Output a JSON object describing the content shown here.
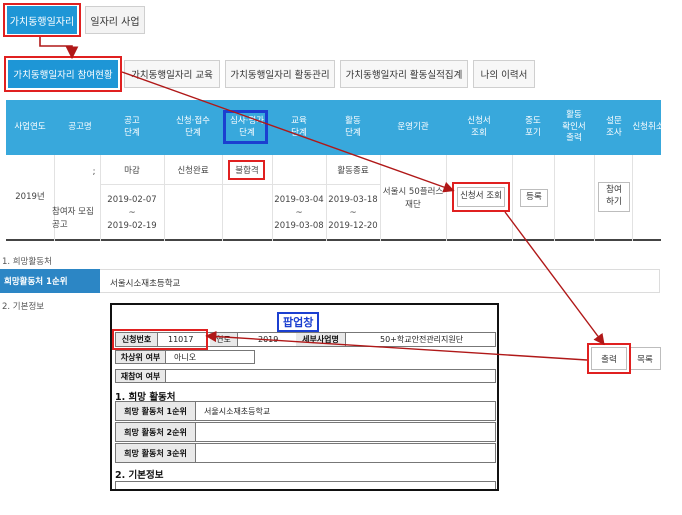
{
  "top_tabs": [
    {
      "label": "가치동행일자리",
      "active": true
    },
    {
      "label": "일자리 사업",
      "active": false
    }
  ],
  "sub_tabs": [
    {
      "label": "가치동행일자리 참여현황",
      "active": true
    },
    {
      "label": "가치동행일자리 교육",
      "active": false
    },
    {
      "label": "가치동행일자리 활동관리",
      "active": false
    },
    {
      "label": "가치동행일자리 활동실적집계",
      "active": false
    },
    {
      "label": "나의 이력서",
      "active": false
    }
  ],
  "table": {
    "headers": [
      "사업연도",
      "공고명",
      "공고\n단계",
      "신청·접수\n단계",
      "심사·평가\n단계",
      "교육\n단계",
      "활동\n단계",
      "운영기관",
      "신청서\n조회",
      "중도\n포기",
      "활동\n확인서\n출력",
      "설문\n조사",
      "신청취소"
    ],
    "row": {
      "year": "2019년",
      "notice_mark": ";",
      "notice_name": "참여자 모집\n공고",
      "notice_stage": "마감",
      "notice_dates": "2019-02-07\n~\n2019-02-19",
      "apply_stage": "신청완료",
      "review_stage": "불합격",
      "edu_dates": "2019-03-04\n~\n2019-03-08",
      "activity_stage": "활동종료",
      "activity_dates": "2019-03-18\n~\n2019-12-20",
      "org": "서울시 50플러스\n재단",
      "view_button": "신청서 조회",
      "quit_button": "등록",
      "survey_button": "참여\n하기"
    }
  },
  "sections": {
    "hope": "1. 희망활동처",
    "hope_label": "희망활동처 1순위",
    "hope_value": "서울시소재초등학교",
    "basic": "2. 기본정보"
  },
  "popup": {
    "title": "팝업창",
    "app_no_label": "신청번호",
    "app_no_value": "11017",
    "year_label": "연도",
    "year_value": "2019",
    "biz_label": "세부사업명",
    "biz_value": "50+학교안전관리지원단",
    "next_label": "차상위 여부",
    "next_value": "아니오",
    "re_label": "재참여 여부",
    "re_value": "",
    "hope_heading": "1. 희망 활동처",
    "hope_rows": [
      {
        "label": "희망 활동처 1순위",
        "value": "서울시소재초등학교"
      },
      {
        "label": "희망 활동처 2순위",
        "value": ""
      },
      {
        "label": "희망 활동처 3순위",
        "value": ""
      }
    ],
    "basic_heading": "2. 기본정보"
  },
  "buttons": {
    "print": "출력",
    "list": "목록"
  },
  "colors": {
    "accent": "#1e96d6",
    "header": "#38a8dc",
    "highlight_red": "#e02020",
    "highlight_blue": "#1b3fd0"
  }
}
